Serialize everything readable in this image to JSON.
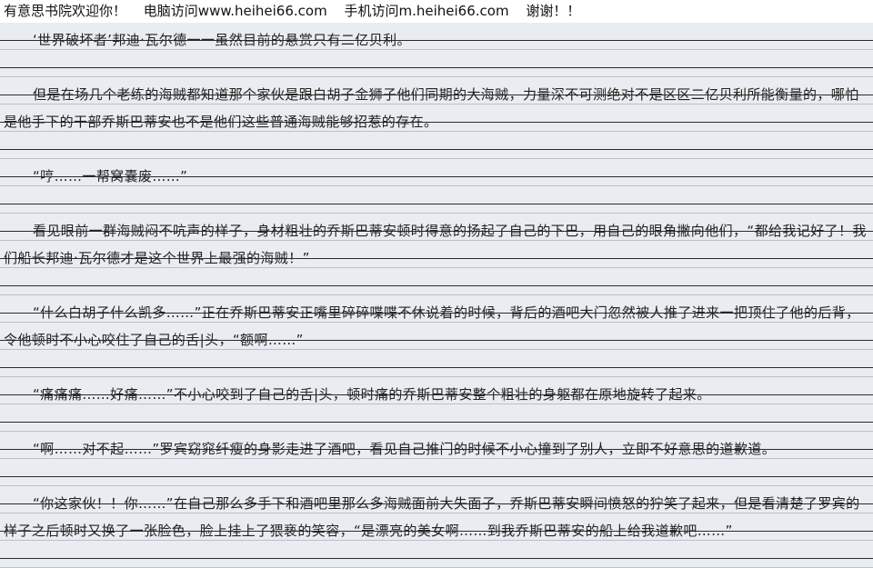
{
  "topbar": {
    "welcome": "有意思书院欢迎你！",
    "pc": "电脑访问www.heihei66.com",
    "mobile": "手机访问m.heihei66.com",
    "thanks": "谢谢！！"
  },
  "paragraphs": [
    "‘世界破坏者’邦迪·瓦尔德一一虽然目前的悬赏只有二亿贝利。",
    "但是在场几个老练的海贼都知道那个家伙是跟白胡子金狮子他们同期的大海贼，力量深不可测绝对不是区区二亿贝利所能衡量的，哪怕是他手下的干部乔斯巴蒂安也不是他们这些普通海贼能够招惹的存在。",
    "“哼……一帮窝囊废……”",
    "看见眼前一群海贼闷不吭声的样子，身材粗壮的乔斯巴蒂安顿时得意的扬起了自己的下巴，用自己的眼角撇向他们，“都给我记好了！我们船长邦迪·瓦尔德才是这个世界上最强的海贼！”",
    "“什么白胡子什么凯多……”正在乔斯巴蒂安正嘴里碎碎喋喋不休说着的时候，背后的酒吧大门忽然被人推了进来一把顶住了他的后背，令他顿时不小心咬住了自己的舌|头，“额啊……”",
    "“痛痛痛……好痛……”不小心咬到了自己的舌|头，顿时痛的乔斯巴蒂安整个粗壮的身躯都在原地旋转了起来。",
    "“啊……对不起……”罗宾窈窕纤瘦的身影走进了酒吧，看见自己推门的时候不小心撞到了别人，立即不好意思的道歉道。",
    "“你这家伙！！你……”在自己那么多手下和酒吧里那么多海贼面前大失面子，乔斯巴蒂安瞬间愤怒的狞笑了起来，但是看清楚了罗宾的样子之后顿时又换了一张脸色，脸上挂上了猥亵的笑容，“是漂亮的美女啊……到我乔斯巴蒂安的船上给我道歉吧……”"
  ]
}
